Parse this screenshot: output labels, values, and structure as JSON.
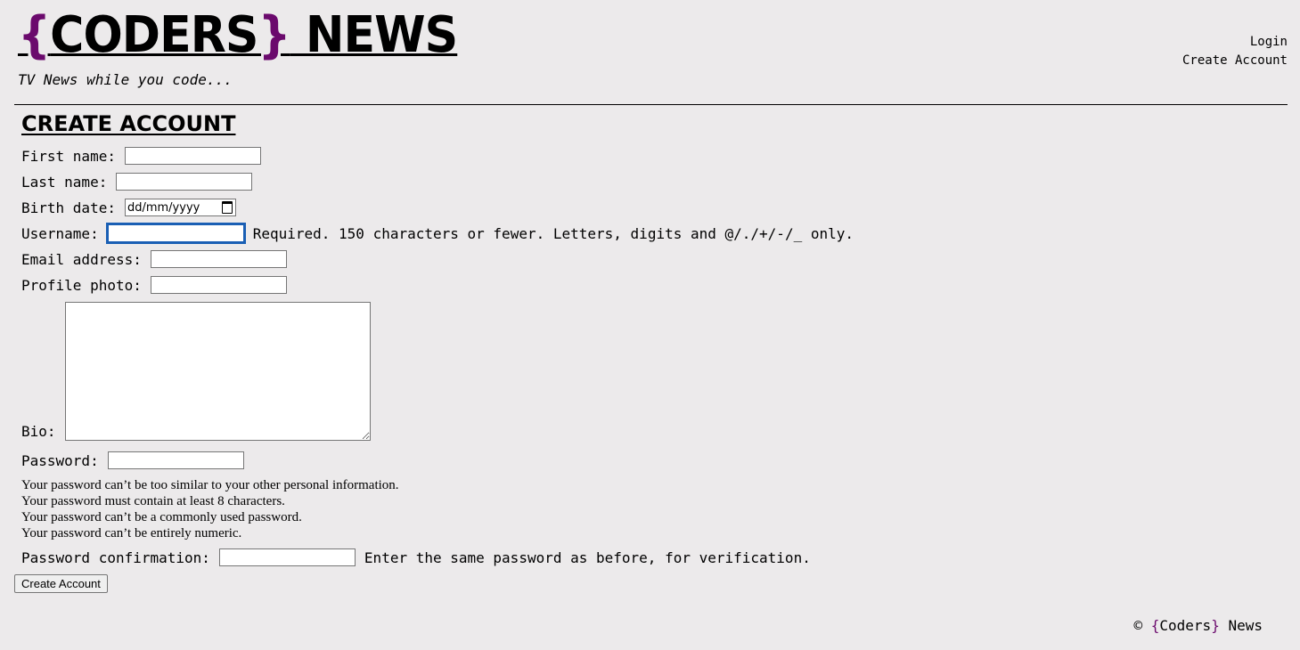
{
  "brand": {
    "open_brace": "{",
    "name": "CODERS",
    "close_brace": "}",
    "rest": " NEWS",
    "tagline": "TV News while you code...",
    "brace_color": "#6b0a6d"
  },
  "nav": {
    "login": "Login",
    "create_account": "Create Account"
  },
  "form": {
    "title": "CREATE ACCOUNT",
    "first_name_label": "First name:",
    "last_name_label": "Last name:",
    "birth_date_label": "Birth date:",
    "birth_date_placeholder": "dd/mm/yyyy",
    "username_label": "Username:",
    "username_help": "Required. 150 characters or fewer. Letters, digits and @/./+/-/_ only.",
    "email_label": "Email address:",
    "profile_photo_label": "Profile photo:",
    "bio_label": "Bio:",
    "password_label": "Password:",
    "password_rules": [
      "Your password can’t be too similar to your other personal information.",
      "Your password must contain at least 8 characters.",
      "Your password can’t be a commonly used password.",
      "Your password can’t be entirely numeric."
    ],
    "password_confirm_label": "Password confirmation:",
    "password_confirm_help": "Enter the same password as before, for verification.",
    "submit_label": "Create Account"
  },
  "footer": {
    "copyright": "©",
    "open_brace": "{",
    "name": "Coders",
    "close_brace": "}",
    "rest": "News"
  }
}
